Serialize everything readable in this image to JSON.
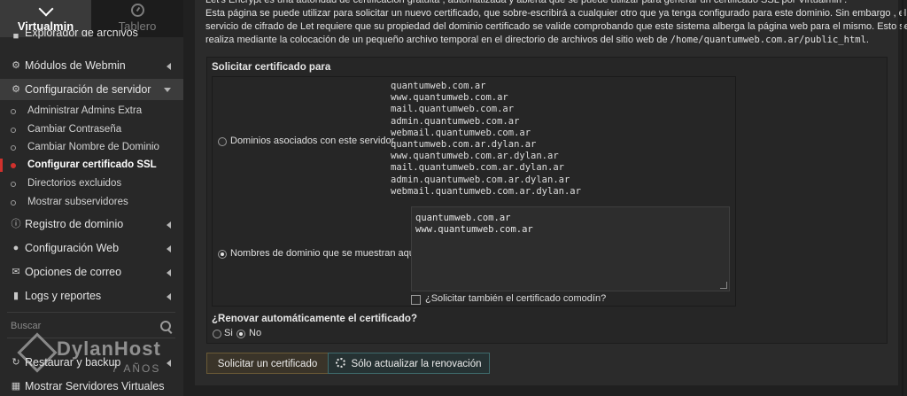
{
  "sidebar": {
    "tabs": [
      {
        "label": "Virtualmin",
        "icon": "chevron-down-icon"
      },
      {
        "label": "Tablero",
        "icon": "dashboard-icon"
      }
    ],
    "items": [
      {
        "label": "Explorador de archivos",
        "icon": "file-manager-icon"
      },
      {
        "label": "Módulos de Webmin",
        "icon": "modules-icon"
      },
      {
        "label": "Configuración de servidor",
        "icon": "gears-icon"
      }
    ],
    "subitems": [
      {
        "label": "Administrar Admins Extra"
      },
      {
        "label": "Cambiar Contraseña"
      },
      {
        "label": "Cambiar Nombre de Dominio"
      },
      {
        "label": "Configurar certificado SSL"
      },
      {
        "label": "Directorios excluidos"
      },
      {
        "label": "Mostrar subservidores"
      }
    ],
    "items2": [
      {
        "label": "Registro de dominio",
        "icon": "info-icon"
      },
      {
        "label": "Configuración Web",
        "icon": "globe-icon"
      },
      {
        "label": "Opciones de correo",
        "icon": "envelope-icon"
      },
      {
        "label": "Logs y reportes",
        "icon": "document-icon"
      }
    ],
    "search": {
      "placeholder": "Buscar"
    },
    "bottom_items": [
      {
        "label": "Restaurar y backup",
        "icon": "restore-icon"
      },
      {
        "label": "Mostrar Servidores Virtuales",
        "icon": "server-icon"
      }
    ],
    "logo": {
      "brand": "DylanHost",
      "years": "7 AÑOS"
    }
  },
  "intro": {
    "line1": "Let's Encrypt es una autoridad de certificación gratuita , automatizada y abierta que se puede utilizar para generar un certificado SSL por Virtualmin .",
    "line2": "Esta página se puede utilizar para solicitar un nuevo certificado, que sobre-escribirá a cualquier otro que ya tenga configurado para este dominio. Sin embargo , el",
    "line3": "servicio de cifrado de Let requiere que su propiedad del dominio certificado se valide comprobando que este sistema alberga la página web para el mismo. Esto se",
    "line4_prefix": "realiza mediante la colocación de un pequeño archivo temporal en el directorio de archivos del sitio web de",
    "line4_path": "/home/quantumweb.com.ar/public_html",
    "line4_suffix": "."
  },
  "form": {
    "title": "Solicitar certificado para",
    "option_associated": "Dominios asociados con este servidor",
    "associated_domains": [
      "quantumweb.com.ar",
      "www.quantumweb.com.ar",
      "mail.quantumweb.com.ar",
      "admin.quantumweb.com.ar",
      "webmail.quantumweb.com.ar",
      "quantumweb.com.ar.dylan.ar",
      "www.quantumweb.com.ar.dylan.ar",
      "mail.quantumweb.com.ar.dylan.ar",
      "admin.quantumweb.com.ar.dylan.ar",
      "webmail.quantumweb.com.ar.dylan.ar"
    ],
    "option_listed": "Nombres de dominio que se muestran aquí",
    "listed_domains": [
      "quantumweb.com.ar",
      "www.quantumweb.com.ar"
    ],
    "wildcard_label": "¿Solicitar también el certificado comodín?",
    "renew_question": "¿Renovar automáticamente el certificado?",
    "renew_yes": "Si",
    "renew_no": "No",
    "selected_option": "listed",
    "renew_selected": "No"
  },
  "buttons": {
    "request": "Solicitar un certificado",
    "renew_only": "Sólo actualizar la renovación"
  }
}
